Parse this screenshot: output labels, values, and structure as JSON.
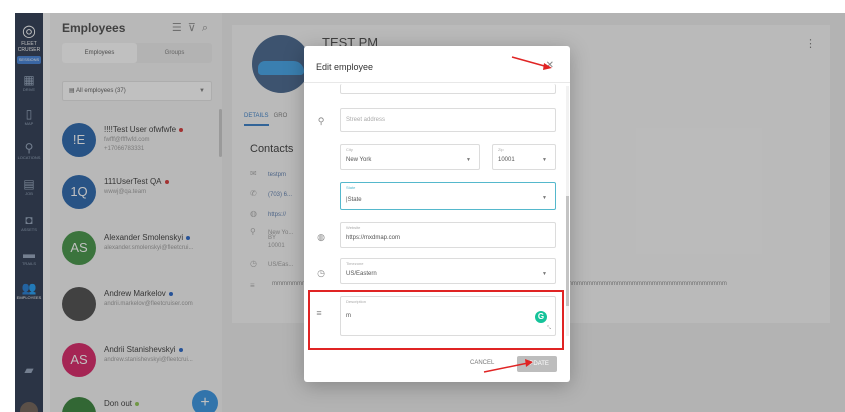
{
  "rail": {
    "brand_line1": "FLEET",
    "brand_line2": "CRUISER",
    "badge": "SESSIONS",
    "items": [
      {
        "label": "DRIVE",
        "icon": "grid-icon"
      },
      {
        "label": "MAP",
        "icon": "map-icon"
      },
      {
        "label": "LOCATIONS",
        "icon": "pin-icon"
      },
      {
        "label": "JOB",
        "icon": "doc-icon"
      },
      {
        "label": "ASSETS",
        "icon": "asset-icon"
      },
      {
        "label": "TRAILS",
        "icon": "truck-icon"
      },
      {
        "label": "EMPLOYEES",
        "icon": "people-icon"
      }
    ]
  },
  "employees": {
    "title": "Employees",
    "tabs": [
      "Employees",
      "Groups"
    ],
    "filter": "All employees (37)",
    "list": [
      {
        "initials": "!E",
        "color": "#1f5fa8",
        "name": "!!!!Test User ofwfwfe",
        "line1": "fwfff@ffffwfd.com",
        "line2": "+17066783331",
        "dot": "#d32f2f"
      },
      {
        "initials": "1Q",
        "color": "#1f5fa8",
        "name": "111UserTest QA",
        "line1": "wwwj@qa.team",
        "line2": "",
        "dot": "#d32f2f"
      },
      {
        "initials": "AS",
        "color": "#3b8f3e",
        "name": "Alexander Smolenskyi",
        "line1": "alexander.smolenskyi@fleetcrui...",
        "line2": "",
        "dot": "#1e5fc4"
      },
      {
        "initials": "",
        "color": "#444444",
        "name": "Andrew Markelov",
        "line1": "andrii.markelov@fleetcruiser.com",
        "line2": "",
        "dot": "#1e5fc4"
      },
      {
        "initials": "AS",
        "color": "#d81b60",
        "name": "Andrii Stanishevskyi",
        "line1": "andrew.stanishevskyi@fleetcrui...",
        "line2": "",
        "dot": "#1e5fc4"
      },
      {
        "initials": "",
        "color": "#2e7d32",
        "name": "Don out",
        "line1": "",
        "line2": "",
        "dot": "#8bc34a"
      }
    ]
  },
  "detail": {
    "name": "TEST PM",
    "tabs": [
      "DETAILS",
      "GRO"
    ],
    "contacts_title": "Contacts",
    "rows": [
      {
        "icon": "mail-icon",
        "value": "testpm"
      },
      {
        "icon": "phone-icon",
        "value": "(703) 6..."
      },
      {
        "icon": "globe-icon",
        "value": "https://"
      },
      {
        "icon": "pin-icon",
        "value": "New Yo..."
      },
      {
        "icon": "clock-icon",
        "value": "US/Eas..."
      }
    ],
    "address_lines": [
      "BY",
      "10001"
    ],
    "long_text": "mmmmmmmmmmmmmmmmmmmmmmmmmmmmmmmmmmmmmmmmmmmmmmmmmmmmmmmmmmmmmmmmmmmmmmmmmmmmmmmmmmmmmmmmmmm"
  },
  "modal": {
    "title": "Edit employee",
    "street_placeholder": "Street address",
    "city_label": "City",
    "city_value": "New York",
    "zip_label": "Zip",
    "zip_value": "10001",
    "state_label": "State",
    "state_value": "State",
    "website_label": "Website",
    "website_value": "https://mxdmap.com",
    "timezone_label": "Timezone",
    "timezone_value": "US/Eastern",
    "description_label": "Description",
    "description_value": "m",
    "cancel_label": "CANCEL",
    "update_label": "UPDATE"
  }
}
